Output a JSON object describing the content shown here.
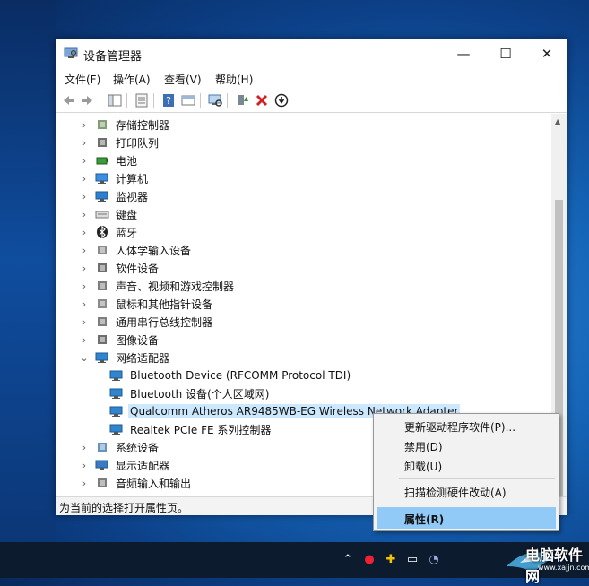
{
  "window": {
    "title": "设备管理器",
    "minimize": "—",
    "maximize": "☐",
    "close": "✕"
  },
  "menu": [
    "文件(F)",
    "操作(A)",
    "查看(V)",
    "帮助(H)"
  ],
  "toolbar_icons": [
    "back-icon",
    "forward-icon",
    "show-hide-tree-icon",
    "properties-icon",
    "help-icon",
    "device-view-icon",
    "scan-hardware-icon",
    "update-driver-icon",
    "uninstall-icon",
    "disable-icon"
  ],
  "tree": [
    {
      "label": "存储控制器",
      "icon": "storage-controller-icon",
      "expander": "›"
    },
    {
      "label": "打印队列",
      "icon": "print-queue-icon",
      "expander": "›"
    },
    {
      "label": "电池",
      "icon": "battery-icon",
      "expander": "›"
    },
    {
      "label": "计算机",
      "icon": "computer-icon",
      "expander": "›"
    },
    {
      "label": "监视器",
      "icon": "monitor-icon",
      "expander": "›"
    },
    {
      "label": "键盘",
      "icon": "keyboard-icon",
      "expander": "›"
    },
    {
      "label": "蓝牙",
      "icon": "bluetooth-icon",
      "expander": "›"
    },
    {
      "label": "人体学输入设备",
      "icon": "hid-icon",
      "expander": "›"
    },
    {
      "label": "软件设备",
      "icon": "software-device-icon",
      "expander": "›"
    },
    {
      "label": "声音、视频和游戏控制器",
      "icon": "sound-icon",
      "expander": "›"
    },
    {
      "label": "鼠标和其他指针设备",
      "icon": "mouse-icon",
      "expander": "›"
    },
    {
      "label": "通用串行总线控制器",
      "icon": "usb-icon",
      "expander": "›"
    },
    {
      "label": "图像设备",
      "icon": "camera-icon",
      "expander": "›"
    },
    {
      "label": "网络适配器",
      "icon": "network-adapter-icon",
      "expander": "⌄"
    },
    {
      "label": "Bluetooth Device (RFCOMM Protocol TDI)",
      "icon": "network-adapter-icon",
      "child": true
    },
    {
      "label": "Bluetooth 设备(个人区域网)",
      "icon": "network-adapter-icon",
      "child": true
    },
    {
      "label": "Qualcomm Atheros AR9485WB-EG Wireless Network Adapter",
      "icon": "network-adapter-icon",
      "child": true,
      "selected": true
    },
    {
      "label": "Realtek PCIe FE 系列控制器",
      "icon": "network-adapter-icon",
      "child": true
    },
    {
      "label": "系统设备",
      "icon": "system-device-icon",
      "expander": "›"
    },
    {
      "label": "显示适配器",
      "icon": "display-adapter-icon",
      "expander": "›"
    },
    {
      "label": "音频输入和输出",
      "icon": "audio-io-icon",
      "expander": "›"
    }
  ],
  "status": "为当前的选择打开属性页。",
  "context_menu": [
    "更新驱动程序软件(P)...",
    "禁用(D)",
    "卸载(U)",
    "扫描检测硬件改动(A)",
    "属性(R)"
  ],
  "watermark": {
    "text": "电脑软件网",
    "url": "www.xajjn.com"
  },
  "colors": {
    "selection": "#cce8ff",
    "context_highlight": "#91c9f7",
    "taskbar": "#0d1b2e"
  }
}
